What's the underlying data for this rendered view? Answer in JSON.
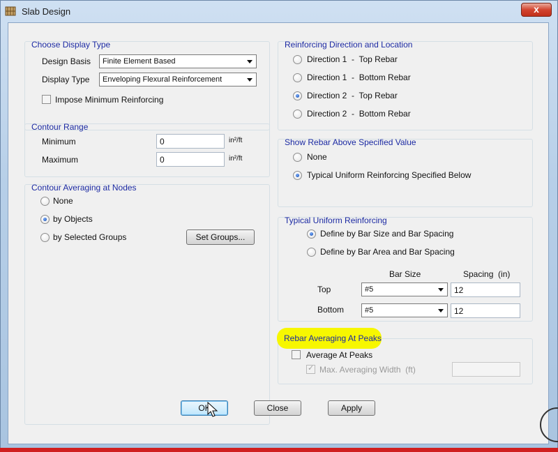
{
  "window": {
    "title": "Slab Design",
    "close_glyph": "x"
  },
  "display_type": {
    "title": "Choose Display Type",
    "design_basis_label": "Design Basis",
    "design_basis_value": "Finite Element Based",
    "display_type_label": "Display Type",
    "display_type_value": "Enveloping Flexural Reinforcement",
    "impose_min_label": "Impose Minimum Reinforcing",
    "impose_min_checked": false
  },
  "contour_range": {
    "title": "Contour Range",
    "minimum_label": "Minimum",
    "minimum_value": "0",
    "maximum_label": "Maximum",
    "maximum_value": "0",
    "unit": "in²/ft"
  },
  "contour_averaging": {
    "title": "Contour Averaging at Nodes",
    "options": [
      "None",
      "by Objects",
      "by Selected Groups"
    ],
    "selected": "by Objects",
    "set_groups_label": "Set Groups..."
  },
  "reinforcing_direction": {
    "title": "Reinforcing Direction and Location",
    "options": [
      "Direction 1  -  Top Rebar",
      "Direction 1  -  Bottom Rebar",
      "Direction 2  -  Top Rebar",
      "Direction 2  -  Bottom Rebar"
    ],
    "selected": "Direction 2  -  Top Rebar"
  },
  "show_rebar": {
    "title": "Show Rebar Above Specified Value",
    "options": [
      "None",
      "Typical Uniform Reinforcing Specified Below"
    ],
    "selected": "Typical Uniform Reinforcing Specified Below"
  },
  "typical_uniform": {
    "title": "Typical Uniform Reinforcing",
    "options": [
      "Define by Bar Size and Bar Spacing",
      "Define by Bar Area and Bar Spacing"
    ],
    "selected": "Define by Bar Size and Bar Spacing",
    "bar_size_header": "Bar Size",
    "spacing_header": "Spacing  (in)",
    "rows": [
      {
        "label": "Top",
        "bar_size": "#5",
        "spacing": "12"
      },
      {
        "label": "Bottom",
        "bar_size": "#5",
        "spacing": "12"
      }
    ]
  },
  "rebar_averaging": {
    "title": "Rebar Averaging At Peaks",
    "average_label": "Average At Peaks",
    "max_width_label": "Max. Averaging Width  (ft)",
    "max_width_value": "",
    "highlight_color": "#f7f700"
  },
  "footer": {
    "ok_label": "OK",
    "close_label": "Close",
    "apply_label": "Apply"
  },
  "colors": {
    "group_title": "#1c2aa3",
    "close_button": "#c1301b"
  }
}
